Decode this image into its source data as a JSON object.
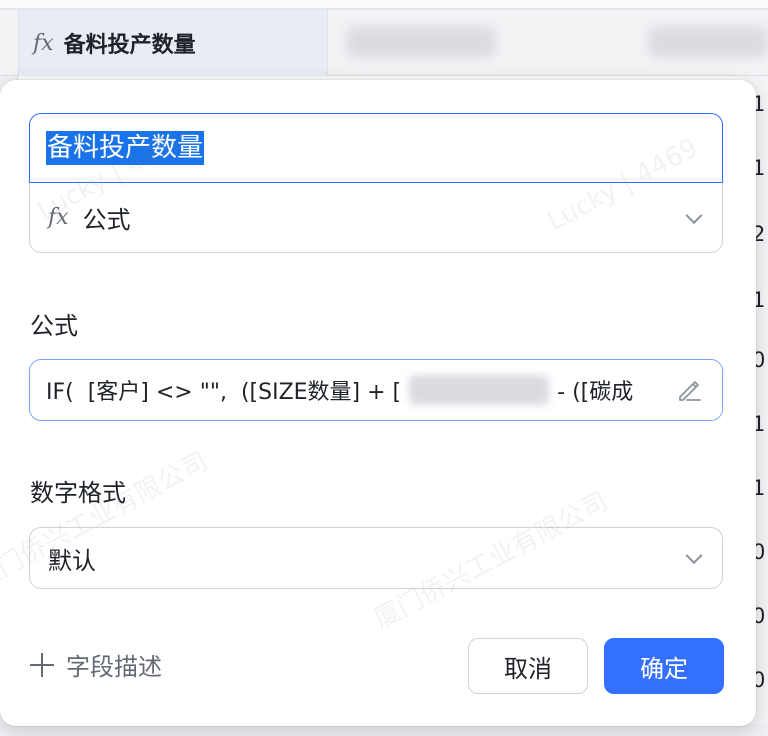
{
  "background": {
    "header_cell_title": "备料投产数量",
    "header_cell_icon": "fx-icon",
    "right_column_partial_values": [
      "1",
      "1",
      "2",
      "1",
      "0",
      "1",
      "1",
      "0",
      "0",
      "0"
    ]
  },
  "modal": {
    "field_name_value": "备料投产数量",
    "field_type": {
      "icon": "fx-icon",
      "label": "公式"
    },
    "formula_section": {
      "label": "公式",
      "formula_start": "IF(  [客户] <> \"\",  ([SIZE数量] + [",
      "formula_end": "- ([碳成",
      "edit_icon": "pencil-icon"
    },
    "number_format_section": {
      "label": "数字格式",
      "value": "默认"
    },
    "add_description_label": "字段描述",
    "cancel_label": "取消",
    "confirm_label": "确定"
  },
  "colors": {
    "accent": "#3370ff",
    "selection": "#1a73e8",
    "border": "#d0d3d6",
    "text_secondary": "#646a73"
  },
  "watermark": {
    "user": "Lucky | 4469",
    "company": "厦门侨兴工业有限公司"
  }
}
